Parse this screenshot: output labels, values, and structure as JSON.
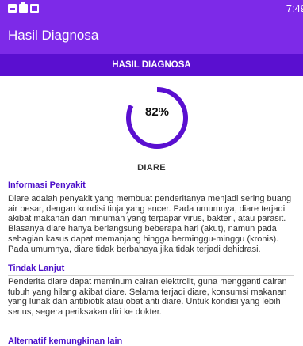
{
  "status_bar": {
    "time": "7:49",
    "icons": [
      "image-icon",
      "briefcase-icon",
      "notification-icon"
    ]
  },
  "app_bar": {
    "title": "Hasil Diagnosa"
  },
  "section_bar": {
    "title": "HASIL DIAGNOSA"
  },
  "result": {
    "percent_label": "82%",
    "percent_value": 0.82,
    "diagnosis": "DIARE",
    "accent_color": "#5a0fd0"
  },
  "info": {
    "heading": "Informasi Penyakit",
    "body": "Diare adalah penyakit yang membuat penderitanya menjadi sering buang air besar, dengan kondisi tinja yang encer. Pada umumnya, diare terjadi akibat makanan dan minuman yang terpapar virus, bakteri, atau parasit. Biasanya diare hanya berlangsung beberapa hari (akut), namun pada sebagian kasus dapat memanjang hingga berminggu-minggu (kronis). Pada umumnya, diare tidak berbahaya jika tidak terjadi dehidrasi."
  },
  "followup": {
    "heading": "Tindak Lanjut",
    "body": "Penderita diare dapat meminum cairan elektrolit, guna mengganti cairan tubuh yang hilang akibat diare. Selama terjadi diare, konsumsi makanan yang lunak dan antibiotik atau obat anti diare. Untuk kondisi yang lebih serius, segera periksakan diri ke dokter."
  },
  "alternatives": {
    "heading": "Alternatif kemungkinan lain"
  },
  "colors": {
    "app_bar": "#7d2ae8",
    "section_bar": "#5a0fd0",
    "heading": "#4b0ec9"
  }
}
